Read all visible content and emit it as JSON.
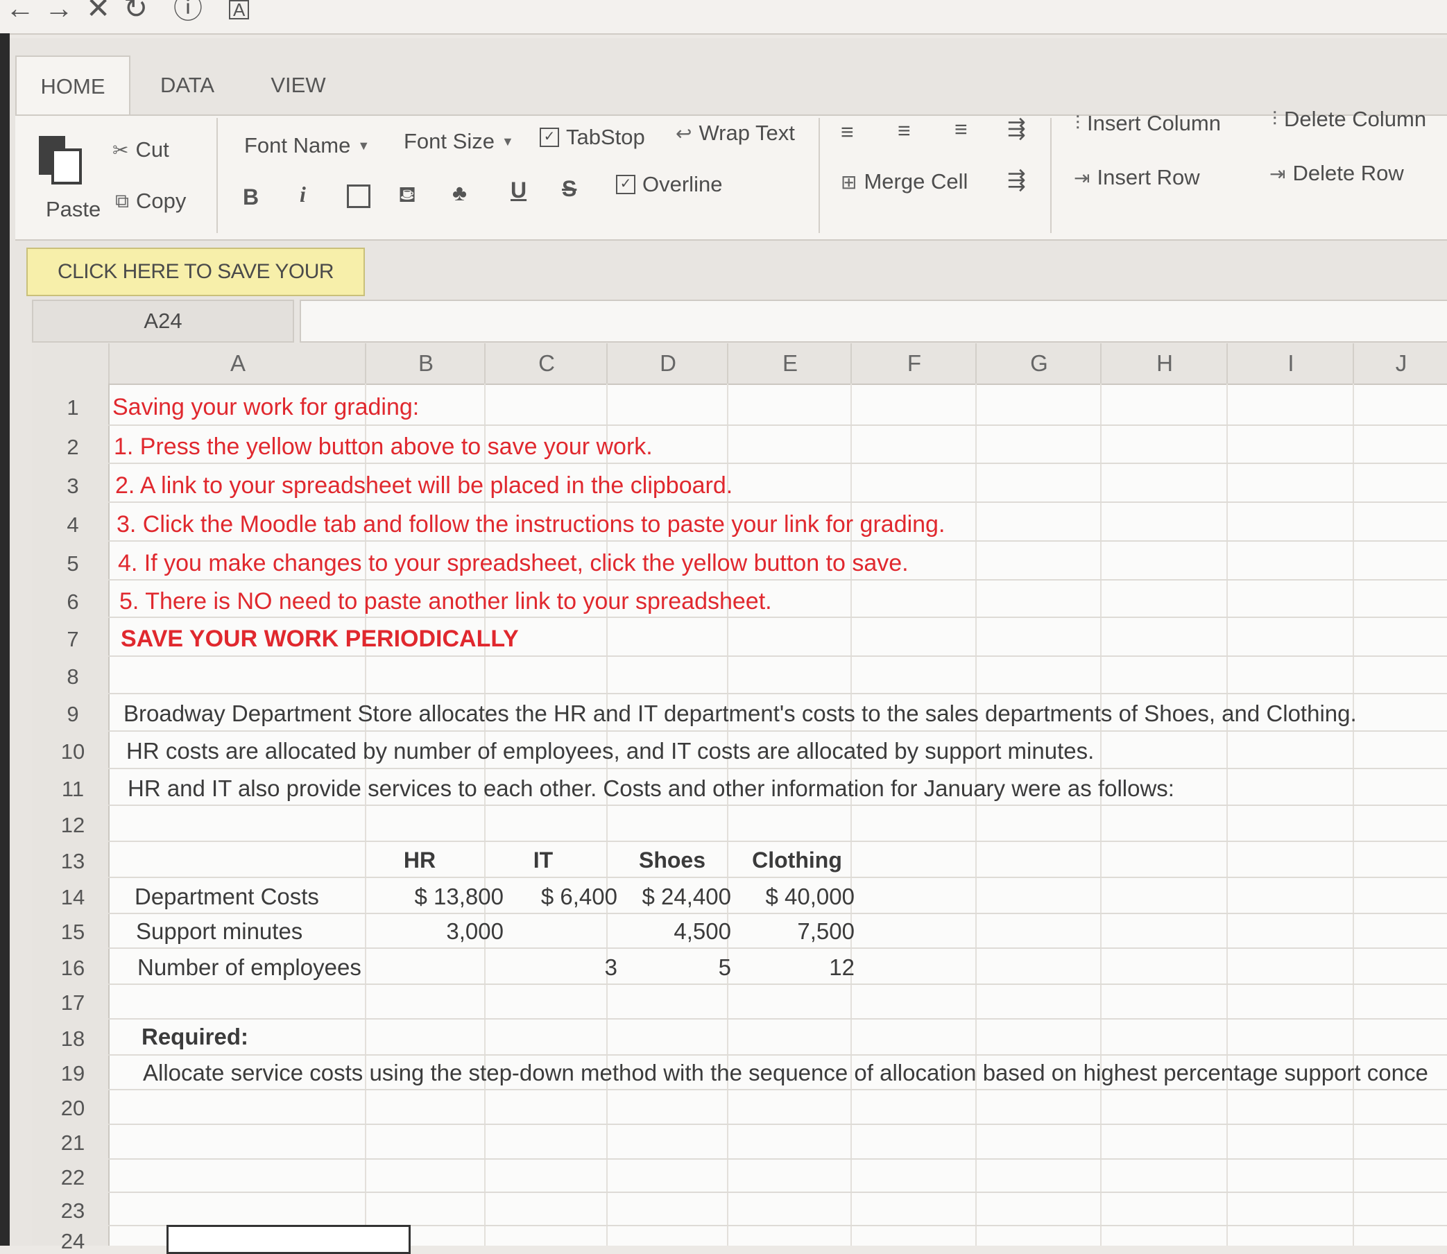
{
  "browser": {
    "back": "←",
    "forward": "→",
    "close": "✕",
    "reload": "↻",
    "info": "ⓘ",
    "toolbar": "A"
  },
  "tabs": [
    "HOME",
    "DATA",
    "VIEW"
  ],
  "ribbon": {
    "paste": "Paste",
    "cut": "Cut",
    "copy": "Copy",
    "font_name": "Font Name",
    "font_size": "Font Size",
    "tabstop": "TabStop",
    "wrap_text": "Wrap Text",
    "overline": "Overline",
    "merge_cell": "Merge Cell",
    "insert_column": "Insert Column",
    "delete_column": "Delete Column",
    "insert_row": "Insert Row",
    "delete_row": "Delete Row",
    "bold": "B",
    "italic": "i",
    "underline": "U",
    "strike": "S"
  },
  "save_button": "CLICK HERE TO SAVE YOUR WORK",
  "name_box": "A24",
  "columns": [
    "A",
    "B",
    "C",
    "D",
    "E",
    "F",
    "G",
    "H",
    "I",
    "J"
  ],
  "rows": [
    "1",
    "2",
    "3",
    "4",
    "5",
    "6",
    "7",
    "8",
    "9",
    "10",
    "11",
    "12",
    "13",
    "14",
    "15",
    "16",
    "17",
    "18",
    "19",
    "20",
    "21",
    "22",
    "23",
    "24"
  ],
  "cells": {
    "r1": "Saving your work for grading:",
    "r2": "1. Press the yellow button above to save your work.",
    "r3": "2. A link to your spreadsheet will be placed in the clipboard.",
    "r4": "3. Click the Moodle tab and follow the instructions to paste your link for grading.",
    "r5": "4. If you make changes to your spreadsheet, click the yellow button to save.",
    "r6": "5. There is NO need to paste another link to your spreadsheet.",
    "r7": "SAVE YOUR WORK PERIODICALLY",
    "r9": "Broadway Department Store allocates the HR and IT department's costs to the sales departments of Shoes, and Clothing.",
    "r10": "HR costs are allocated by number of employees, and IT costs are allocated by support minutes.",
    "r11": "HR and IT also provide services to each other. Costs and other information for January were as follows:",
    "r18": "Required:",
    "r19": "Allocate service costs using the step-down method with the sequence of allocation based on highest percentage support conce"
  },
  "table": {
    "headers": [
      "HR",
      "IT",
      "Shoes",
      "Clothing"
    ],
    "rows": [
      {
        "label": "Department Costs",
        "values": [
          "$ 13,800",
          "$ 6,400",
          "$ 24,400",
          "$ 40,000"
        ]
      },
      {
        "label": "Support minutes",
        "values": [
          "3,000",
          "",
          "4,500",
          "7,500"
        ]
      },
      {
        "label": "Number of employees",
        "values": [
          "",
          "3",
          "5",
          "12"
        ]
      }
    ]
  }
}
